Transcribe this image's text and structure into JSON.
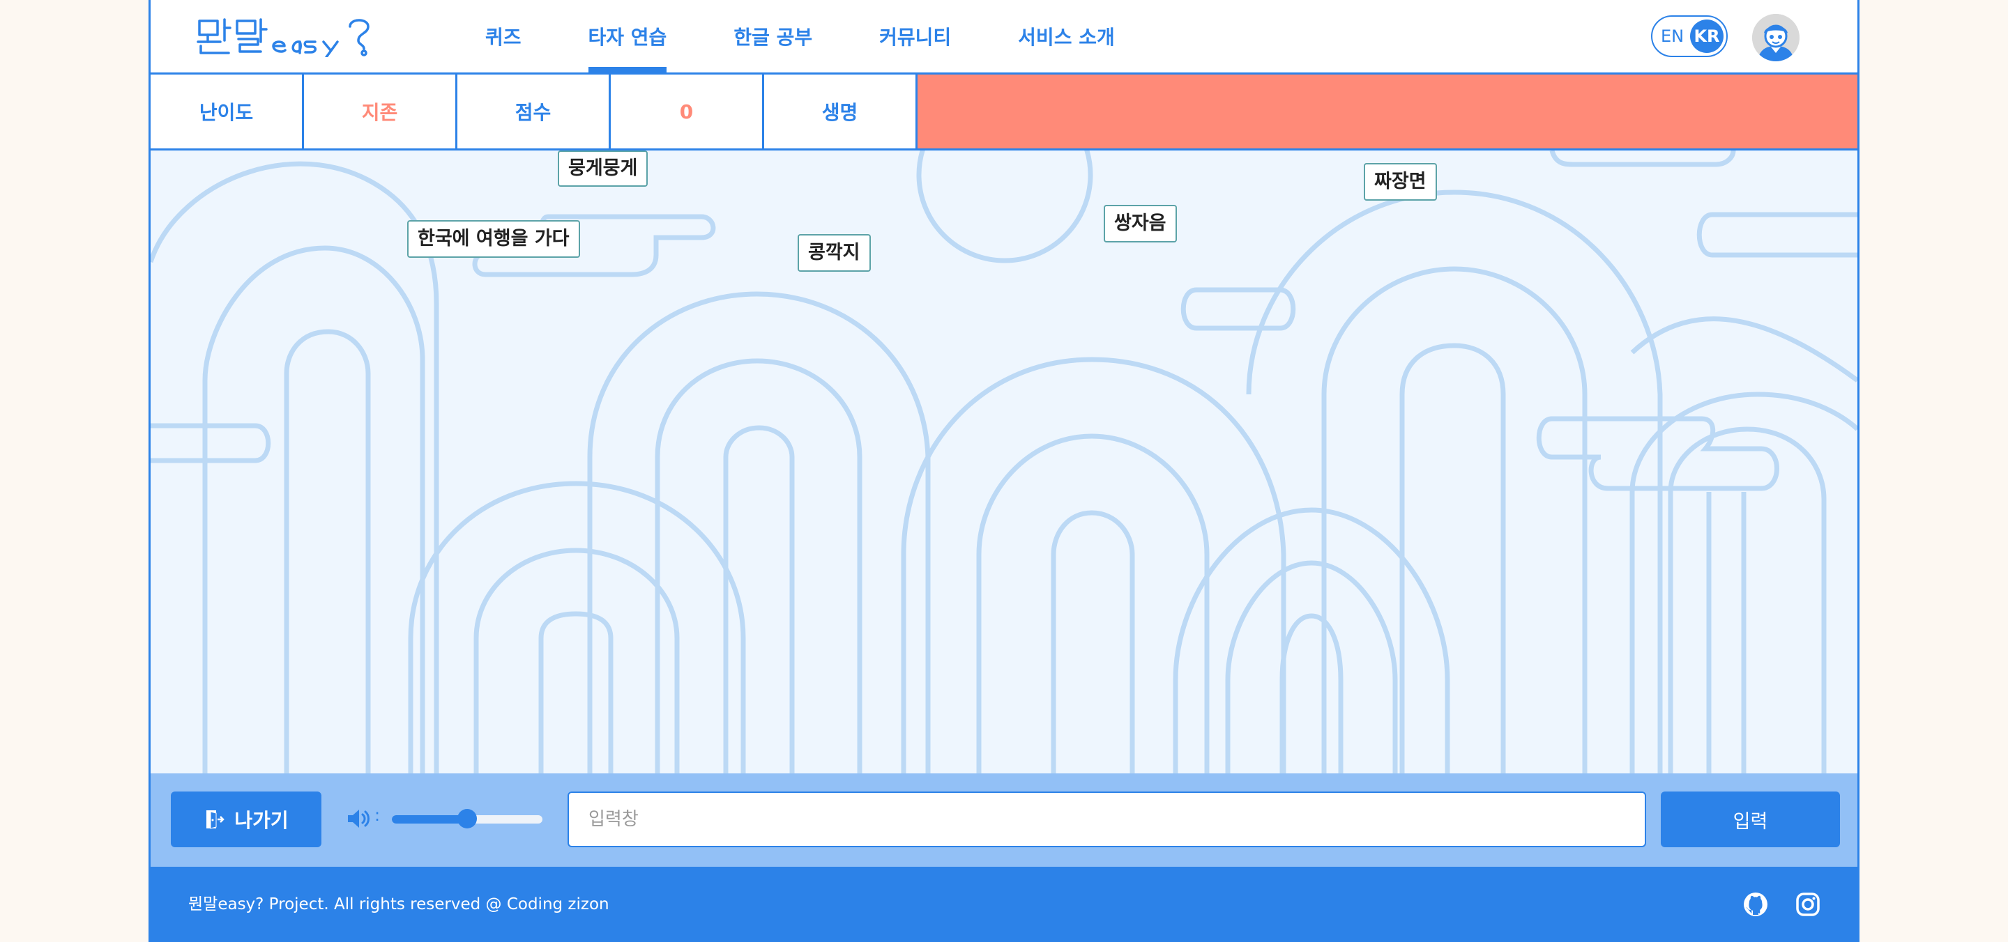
{
  "header": {
    "logo_text": "뭔말easy?",
    "nav": [
      {
        "label": "퀴즈",
        "active": false
      },
      {
        "label": "타자 연습",
        "active": true
      },
      {
        "label": "한글 공부",
        "active": false
      },
      {
        "label": "커뮤니티",
        "active": false
      },
      {
        "label": "서비스 소개",
        "active": false
      }
    ],
    "lang_en": "EN",
    "lang_kr": "KR",
    "avatar_icon": "user-avatar-icon"
  },
  "stats": {
    "difficulty_label": "난이도",
    "difficulty_value": "지존",
    "score_label": "점수",
    "score_value": "0",
    "life_label": "생명",
    "life_level": 1.0,
    "life_color": "#ff8a78"
  },
  "game": {
    "words": [
      {
        "text": "뭉게뭉게"
      },
      {
        "text": "한국에 여행을 가다"
      },
      {
        "text": "콩깍지"
      },
      {
        "text": "쌍자음"
      },
      {
        "text": "짜장면"
      }
    ]
  },
  "controls": {
    "exit_label": "나가기",
    "exit_icon": "exit-door-icon",
    "volume_icon": "speaker-icon",
    "volume_colon": ":",
    "volume_level": 0.5,
    "input_placeholder": "입력창",
    "input_value": "",
    "submit_label": "입력"
  },
  "footer": {
    "copyright": "뭔말easy? Project. All rights reserved @ Coding zizon",
    "github_icon": "github-icon",
    "instagram_icon": "instagram-icon"
  },
  "colors": {
    "primary": "#2c82e8",
    "accent_red": "#ff8a78",
    "game_bg": "#eef6fe",
    "control_bg": "#92c0f6",
    "page_bg": "#fdf8f2"
  }
}
